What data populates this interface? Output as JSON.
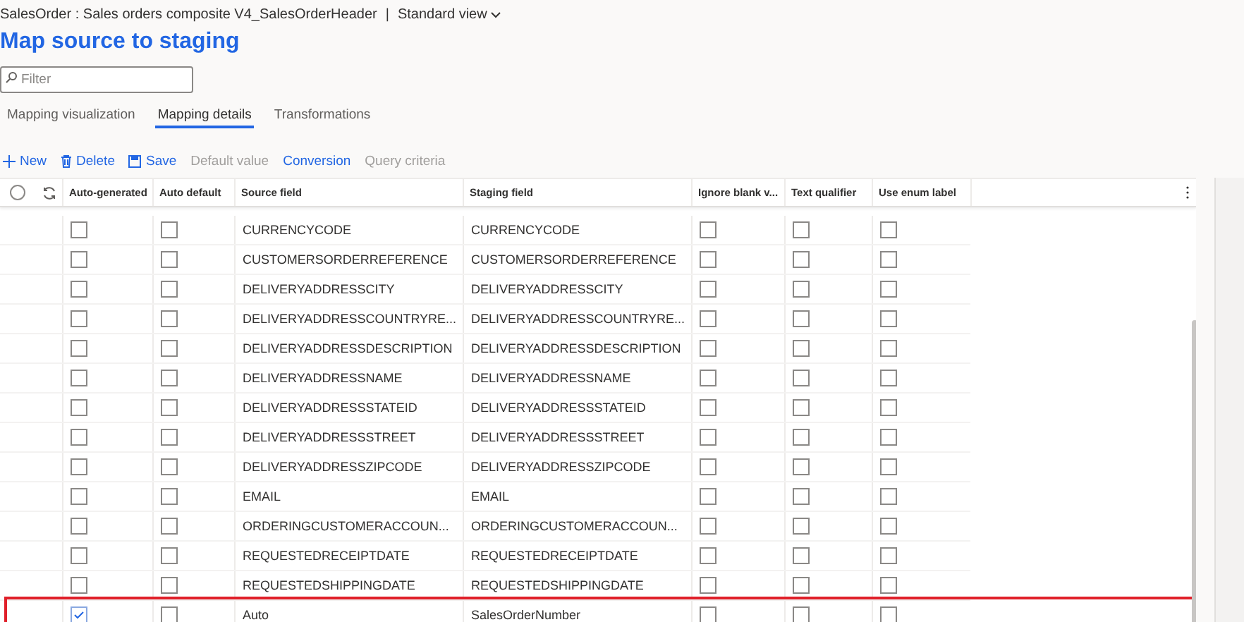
{
  "breadcrumb": {
    "path": "SalesOrder : Sales orders composite V4_SalesOrderHeader",
    "separator": "|",
    "view": "Standard view"
  },
  "title": "Map source to staging",
  "filter": {
    "placeholder": "Filter"
  },
  "tabs": [
    {
      "label": "Mapping visualization",
      "selected": false
    },
    {
      "label": "Mapping details",
      "selected": true
    },
    {
      "label": "Transformations",
      "selected": false
    }
  ],
  "toolbar": [
    {
      "label": "New",
      "disabled": false
    },
    {
      "label": "Delete",
      "disabled": false
    },
    {
      "label": "Save",
      "disabled": false
    },
    {
      "label": "Default value",
      "disabled": true
    },
    {
      "label": "Conversion",
      "disabled": false
    },
    {
      "label": "Query criteria",
      "disabled": true
    }
  ],
  "table": {
    "columns": [
      "Auto-generated",
      "Auto default",
      "Source field",
      "Staging field",
      "Ignore blank v...",
      "Text qualifier",
      "Use enum label"
    ],
    "rows": [
      {
        "auto_generated": false,
        "auto_default": false,
        "source": "CURRENCYCODE",
        "staging": "CURRENCYCODE",
        "ignore_blank": false,
        "text_qualifier": false,
        "use_enum_label": false,
        "highlighted": false
      },
      {
        "auto_generated": false,
        "auto_default": false,
        "source": "CUSTOMERSORDERREFERENCE",
        "staging": "CUSTOMERSORDERREFERENCE",
        "ignore_blank": false,
        "text_qualifier": false,
        "use_enum_label": false,
        "highlighted": false
      },
      {
        "auto_generated": false,
        "auto_default": false,
        "source": "DELIVERYADDRESSCITY",
        "staging": "DELIVERYADDRESSCITY",
        "ignore_blank": false,
        "text_qualifier": false,
        "use_enum_label": false,
        "highlighted": false
      },
      {
        "auto_generated": false,
        "auto_default": false,
        "source": "DELIVERYADDRESSCOUNTRYRE...",
        "staging": "DELIVERYADDRESSCOUNTRYRE...",
        "ignore_blank": false,
        "text_qualifier": false,
        "use_enum_label": false,
        "highlighted": false
      },
      {
        "auto_generated": false,
        "auto_default": false,
        "source": "DELIVERYADDRESSDESCRIPTION",
        "staging": "DELIVERYADDRESSDESCRIPTION",
        "ignore_blank": false,
        "text_qualifier": false,
        "use_enum_label": false,
        "highlighted": false
      },
      {
        "auto_generated": false,
        "auto_default": false,
        "source": "DELIVERYADDRESSNAME",
        "staging": "DELIVERYADDRESSNAME",
        "ignore_blank": false,
        "text_qualifier": false,
        "use_enum_label": false,
        "highlighted": false
      },
      {
        "auto_generated": false,
        "auto_default": false,
        "source": "DELIVERYADDRESSSTATEID",
        "staging": "DELIVERYADDRESSSTATEID",
        "ignore_blank": false,
        "text_qualifier": false,
        "use_enum_label": false,
        "highlighted": false
      },
      {
        "auto_generated": false,
        "auto_default": false,
        "source": "DELIVERYADDRESSSTREET",
        "staging": "DELIVERYADDRESSSTREET",
        "ignore_blank": false,
        "text_qualifier": false,
        "use_enum_label": false,
        "highlighted": false
      },
      {
        "auto_generated": false,
        "auto_default": false,
        "source": "DELIVERYADDRESSZIPCODE",
        "staging": "DELIVERYADDRESSZIPCODE",
        "ignore_blank": false,
        "text_qualifier": false,
        "use_enum_label": false,
        "highlighted": false
      },
      {
        "auto_generated": false,
        "auto_default": false,
        "source": "EMAIL",
        "staging": "EMAIL",
        "ignore_blank": false,
        "text_qualifier": false,
        "use_enum_label": false,
        "highlighted": false
      },
      {
        "auto_generated": false,
        "auto_default": false,
        "source": "ORDERINGCUSTOMERACCOUN...",
        "staging": "ORDERINGCUSTOMERACCOUN...",
        "ignore_blank": false,
        "text_qualifier": false,
        "use_enum_label": false,
        "highlighted": false
      },
      {
        "auto_generated": false,
        "auto_default": false,
        "source": "REQUESTEDRECEIPTDATE",
        "staging": "REQUESTEDRECEIPTDATE",
        "ignore_blank": false,
        "text_qualifier": false,
        "use_enum_label": false,
        "highlighted": false
      },
      {
        "auto_generated": false,
        "auto_default": false,
        "source": "REQUESTEDSHIPPINGDATE",
        "staging": "REQUESTEDSHIPPINGDATE",
        "ignore_blank": false,
        "text_qualifier": false,
        "use_enum_label": false,
        "highlighted": false
      },
      {
        "auto_generated": true,
        "auto_default": false,
        "source": "Auto",
        "staging": "SalesOrderNumber",
        "ignore_blank": false,
        "text_qualifier": false,
        "use_enum_label": false,
        "highlighted": true
      }
    ]
  }
}
